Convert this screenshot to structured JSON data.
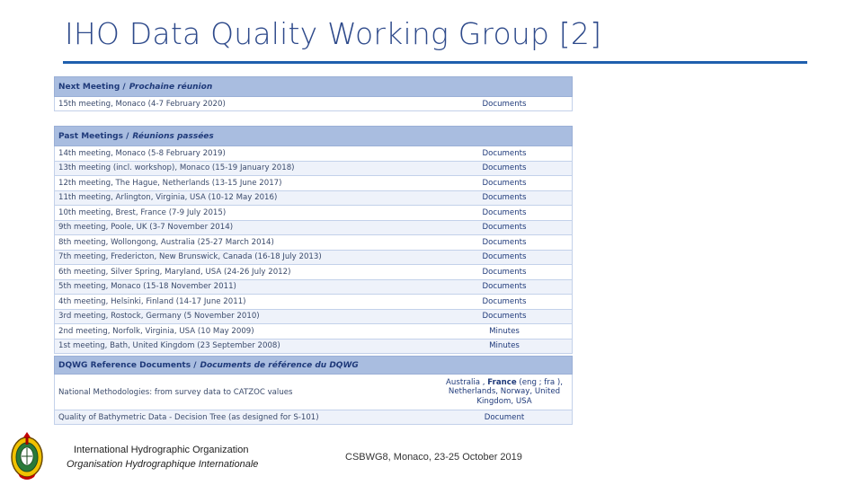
{
  "slide": {
    "title": "IHO Data Quality Working Group [2]"
  },
  "next_meeting": {
    "header_en": "Next Meeting /",
    "header_fr": "Prochaine réunion",
    "rows": [
      {
        "label": "15th meeting, Monaco (4-7 February 2020)",
        "link": "Documents"
      }
    ]
  },
  "past_meetings": {
    "header_en": "Past Meetings /",
    "header_fr": "Réunions passées",
    "rows": [
      {
        "label": "14th meeting, Monaco (5-8 February 2019)",
        "link": "Documents"
      },
      {
        "label": "13th meeting (incl. workshop), Monaco (15-19 January 2018)",
        "link": "Documents"
      },
      {
        "label": "12th meeting, The Hague, Netherlands (13-15 June 2017)",
        "link": "Documents"
      },
      {
        "label": "11th meeting, Arlington, Virginia, USA (10-12 May 2016)",
        "link": "Documents"
      },
      {
        "label": "10th meeting, Brest, France (7-9 July 2015)",
        "link": "Documents"
      },
      {
        "label": "9th meeting, Poole, UK (3-7 November 2014)",
        "link": "Documents"
      },
      {
        "label": "8th meeting, Wollongong, Australia (25-27 March 2014)",
        "link": "Documents"
      },
      {
        "label": "7th meeting, Fredericton, New Brunswick, Canada (16-18 July 2013)",
        "link": "Documents"
      },
      {
        "label": "6th meeting, Silver Spring, Maryland, USA (24-26 July 2012)",
        "link": "Documents"
      },
      {
        "label": "5th meeting, Monaco (15-18 November 2011)",
        "link": "Documents"
      },
      {
        "label": "4th meeting, Helsinki, Finland (14-17 June 2011)",
        "link": "Documents"
      },
      {
        "label": "3rd meeting, Rostock, Germany (5 November 2010)",
        "link": "Documents"
      },
      {
        "label": "2nd meeting, Norfolk, Virginia, USA (10 May 2009)",
        "link": "Minutes"
      },
      {
        "label": "1st meeting, Bath, United Kingdom (23 September 2008)",
        "link": "Minutes"
      }
    ]
  },
  "reference_docs": {
    "header_en": "DQWG Reference Documents /",
    "header_fr": "Documents de référence du DQWG",
    "rows": [
      {
        "label": "National Methodologies: from survey data to CATZOC values",
        "link_pre": "Australia , ",
        "link_bold": "France",
        "link_post": " (eng ; fra ), Netherlands, Norway, United Kingdom, USA"
      },
      {
        "label": "Quality of Bathymetric Data - Decision Tree (as designed for S-101)",
        "link": "Document"
      }
    ]
  },
  "footer": {
    "org_en": "International Hydrographic Organization",
    "org_fr": "Organisation Hydrographique Internationale",
    "meeting": "CSBWG8, Monaco, 23-25 October 2019"
  },
  "colors": {
    "title": "#2e4a8b",
    "rule": "#1f5fae",
    "header_bg": "#a9bde0",
    "row_alt": "#eef2fa"
  }
}
